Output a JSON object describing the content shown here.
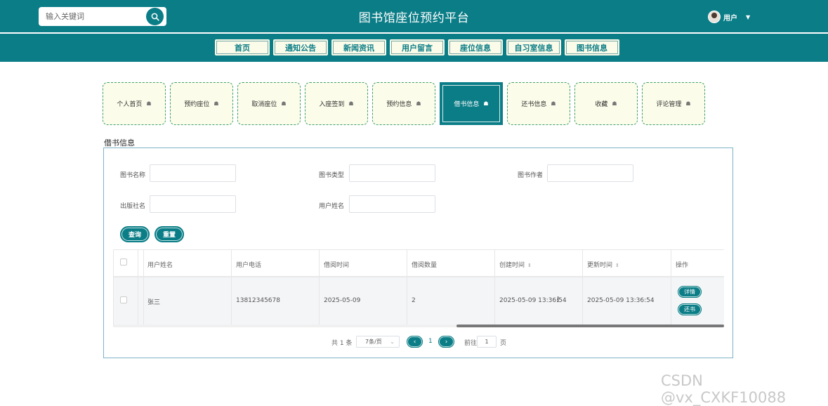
{
  "header": {
    "search_placeholder": "输入关键词",
    "site_title": "图书馆座位预约平台",
    "user_label": "用户",
    "icons": {
      "search": "search-icon",
      "avatar": "avatar",
      "caret": "chevron-down-icon"
    }
  },
  "nav": {
    "items": [
      {
        "label": "首页"
      },
      {
        "label": "通知公告"
      },
      {
        "label": "新闻资讯"
      },
      {
        "label": "用户留言"
      },
      {
        "label": "座位信息"
      },
      {
        "label": "自习室信息"
      },
      {
        "label": "图书信息"
      }
    ]
  },
  "tabs": {
    "items": [
      {
        "label": "个人首页",
        "active": false
      },
      {
        "label": "预约座位",
        "active": false
      },
      {
        "label": "取消座位",
        "active": false
      },
      {
        "label": "入座签到",
        "active": false
      },
      {
        "label": "预约信息",
        "active": false
      },
      {
        "label": "借书信息",
        "active": true
      },
      {
        "label": "还书信息",
        "active": false
      },
      {
        "label": "收藏",
        "active": false
      },
      {
        "label": "评论管理",
        "active": false
      }
    ],
    "icon": "home-icon"
  },
  "section": {
    "title": "借书信息"
  },
  "filters": {
    "book_name_label": "图书名称",
    "book_type_label": "图书类型",
    "book_author_label": "图书作者",
    "publisher_label": "出版社名",
    "user_name_label": "用户姓名",
    "book_name_value": "",
    "book_type_value": "",
    "book_author_value": "",
    "publisher_value": "",
    "user_name_value": "",
    "search_button": "查询",
    "reset_button": "重置"
  },
  "table": {
    "columns": {
      "user_name": "用户姓名",
      "user_phone": "用户电话",
      "borrow_time": "借阅时间",
      "borrow_count": "借阅数量",
      "created_time": "创建时间",
      "updated_time": "更新时间",
      "actions": "操作"
    },
    "rows": [
      {
        "user_name": "张三",
        "user_phone": "13812345678",
        "borrow_time": "2025-05-09",
        "borrow_count": "2",
        "created_time": "2025-05-09 13:36:54",
        "updated_time": "2025-05-09 13:36:54",
        "detail_button": "详情",
        "return_button": "还书"
      }
    ]
  },
  "pagination": {
    "total_text": "共 1 条",
    "page_size": "7条/页",
    "current_page": "1",
    "goto_label": "前往",
    "goto_value": "1",
    "page_suffix": "页"
  },
  "watermark": "CSDN @vx_CXKF10088",
  "colors": {
    "primary": "#0b7d87",
    "nav_bg": "#fbfbe9",
    "tab_bg": "#fcfcea"
  }
}
